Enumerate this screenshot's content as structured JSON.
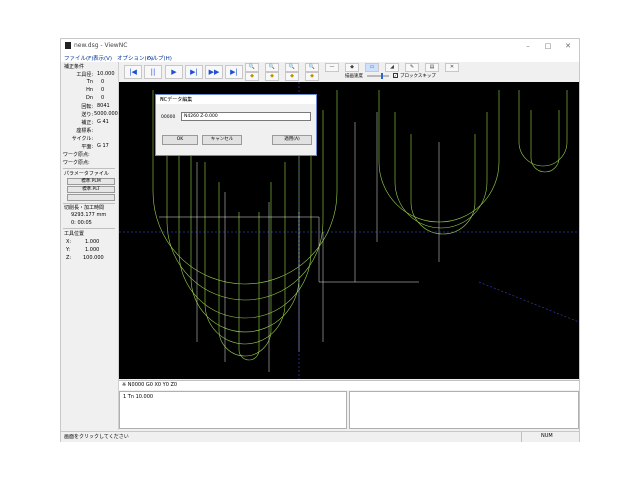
{
  "window": {
    "title": "new.dsg - ViewNC",
    "min_glyph": "–",
    "max_glyph": "□",
    "close_glyph": "✕"
  },
  "menu": [
    "ファイル(F)",
    "表示(V)",
    "オプション(O)",
    "ヘルプ(H)"
  ],
  "left_panel": {
    "section_title": "補正条件",
    "rows": [
      {
        "label": "工具径:",
        "value": "10.000"
      },
      {
        "label": "Tn",
        "value": "0"
      },
      {
        "label": "Hn",
        "value": "0"
      },
      {
        "label": "Dn",
        "value": "0"
      },
      {
        "label": "回転:",
        "value": "8041"
      },
      {
        "label": "送り:",
        "value": "5000.000"
      },
      {
        "label": "補正:",
        "value": "G 41"
      },
      {
        "label": "座標系:",
        "value": ""
      },
      {
        "label": "サイクル:",
        "value": ""
      },
      {
        "label": "平面:",
        "value": "G 17"
      },
      {
        "label": "ワーク原点:",
        "value": ""
      },
      {
        "label": "ワーク原点:",
        "value": ""
      }
    ],
    "param_title": "パラメータファイル",
    "param_buttons": [
      "標準.PLM",
      "標準.PLT",
      ""
    ],
    "time_title": "切削長・加工時間",
    "length_value": "9293.177 mm",
    "time_value": "0: 00:05",
    "tool_pos_title": "工具位置",
    "tool_pos": [
      {
        "axis": "X:",
        "value": "1.000"
      },
      {
        "axis": "Y:",
        "value": "1.000"
      },
      {
        "axis": "Z:",
        "value": "100.000"
      }
    ]
  },
  "toolbar": {
    "nav_icons": [
      "skip-start-icon",
      "pause-icon",
      "play-icon",
      "step-icon",
      "fast-forward-icon",
      "skip-end-icon"
    ],
    "nav_glyphs": [
      "|◀",
      "||",
      "▶",
      "▶|",
      "▶▶",
      "▶|"
    ],
    "view_glyphs": [
      "🔍",
      "🔍",
      "🔍",
      "🔍",
      "—",
      "◆",
      "▭",
      "◢",
      "✎",
      "▤",
      "✕"
    ],
    "view_glyphs_row2": [
      "◆",
      "◆",
      "◆",
      "◆"
    ],
    "speed_label": "描画速度",
    "snap_label": "ブロックスキップ",
    "snap_checked": true
  },
  "dialog": {
    "title": "NCデータ編集",
    "close_glyph": "✕",
    "field_label": "00000",
    "field_value": "N4260 Z-0.000",
    "ok_label": "OK",
    "cancel_label": "キャンセル",
    "apply_label": "適用(A)"
  },
  "command_bar": {
    "text": "※ N0000 G0 X0 Y0 Z0"
  },
  "bottom_panes": {
    "left_text": "1 Tn     10.000",
    "right_text": ""
  },
  "status": {
    "message": "画面をクリックしてください",
    "mode": "NUM"
  },
  "colors": {
    "canvas_bg": "#000000",
    "path_green": "#9ad24a",
    "path_white": "#e8e8e8",
    "axis_blue": "#3a5cff"
  }
}
